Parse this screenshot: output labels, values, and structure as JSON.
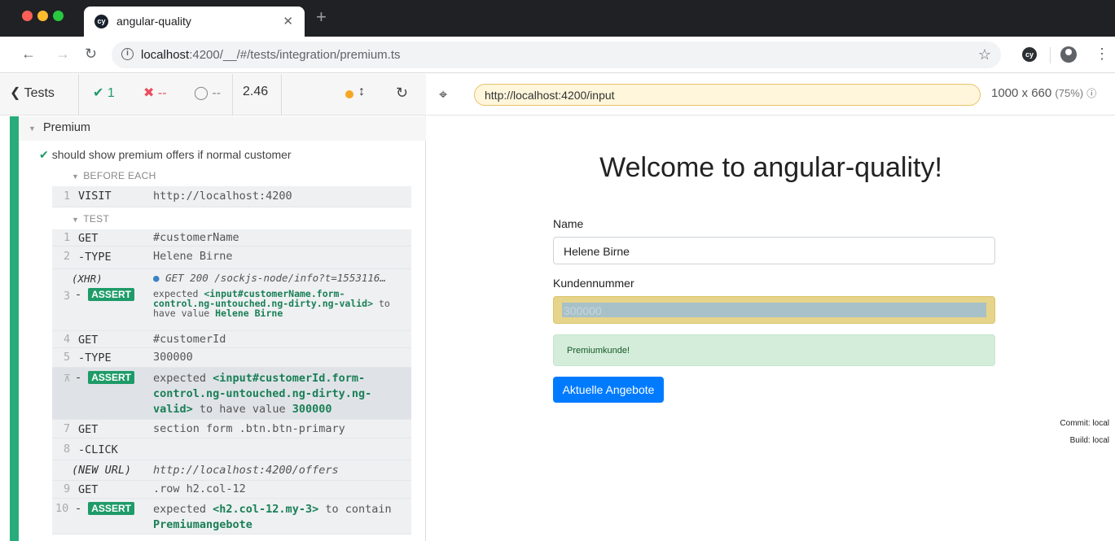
{
  "browser": {
    "tab_title": "angular-quality",
    "tab_icon": "cy",
    "url_host": "localhost",
    "url_rest": ":4200/__/#/tests/integration/premium.ts"
  },
  "reporter": {
    "tests_label": "Tests",
    "passed": "1",
    "failed": "--",
    "pending": "--",
    "duration": "2.46",
    "suite_title": "Premium",
    "test_title": "should show premium offers if normal customer",
    "before_each_label": "BEFORE EACH",
    "test_label": "TEST",
    "commands": [
      {
        "num": "1",
        "name": "VISIT",
        "msg": "http://localhost:4200"
      },
      {
        "num": "1",
        "name": "GET",
        "msg": "#customerName"
      },
      {
        "num": "2",
        "name": "-TYPE",
        "msg": "Helene Birne"
      },
      {
        "num": "",
        "name": "(XHR)",
        "msg": "GET 200 /sockjs-node/info?t=1553116…"
      },
      {
        "num": "3",
        "name": "-ASSERT",
        "msg_a": "expected ",
        "msg_b": "<input#customerName.form-control.ng-untouched.ng-dirty.ng-valid>",
        "msg_c": " to have value ",
        "msg_d": "Helene Birne"
      },
      {
        "num": "4",
        "name": "GET",
        "msg": "#customerId"
      },
      {
        "num": "5",
        "name": "-TYPE",
        "msg": "300000"
      },
      {
        "num": "",
        "name": "-ASSERT",
        "msg_a": "expected ",
        "msg_b": "<input#customerId.form-control.ng-untouched.ng-dirty.ng-valid>",
        "msg_c": " to have value ",
        "msg_d": "300000"
      },
      {
        "num": "7",
        "name": "GET",
        "msg": "section form .btn.btn-primary"
      },
      {
        "num": "8",
        "name": "-CLICK",
        "msg": ""
      },
      {
        "num": "",
        "name": "(NEW URL)",
        "msg": "http://localhost:4200/offers"
      },
      {
        "num": "9",
        "name": "GET",
        "msg": ".row h2.col-12"
      },
      {
        "num": "10",
        "name": "-ASSERT",
        "msg_a": "expected ",
        "msg_b": "<h2.col-12.my-3>",
        "msg_c": " to contain ",
        "msg_d": "Premiumangebote"
      }
    ]
  },
  "aut_bar": {
    "url": "http://localhost:4200/input",
    "viewport": "1000 x 660",
    "scale": "(75%)"
  },
  "app": {
    "heading": "Welcome to angular-quality!",
    "name_label": "Name",
    "name_value": "Helene Birne",
    "customer_number_label": "Kundennummer",
    "customer_number_value": "300000",
    "alert_text": "Premiumkunde!",
    "button_label": "Aktuelle Angebote",
    "commit": "Commit: local",
    "build": "Build: local"
  },
  "colors": {
    "pass": "#1e9b68",
    "fail": "#e94f5f",
    "primary": "#007bff"
  }
}
